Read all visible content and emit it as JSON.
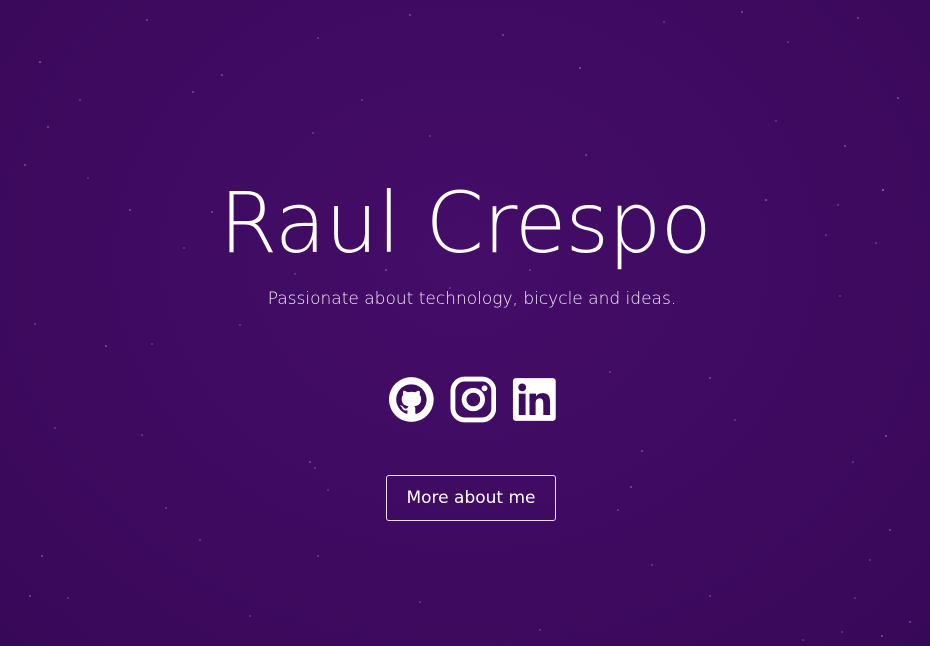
{
  "hero": {
    "title": "Raul Crespo",
    "tagline": "Passionate about technology, bicycle and ideas."
  },
  "socials": [
    {
      "name": "github",
      "icon": "github-icon"
    },
    {
      "name": "instagram",
      "icon": "instagram-icon"
    },
    {
      "name": "linkedin",
      "icon": "linkedin-icon"
    }
  ],
  "cta": {
    "label": "More about me"
  },
  "colors": {
    "background": "#3f0b61",
    "text": "#ffffff"
  }
}
